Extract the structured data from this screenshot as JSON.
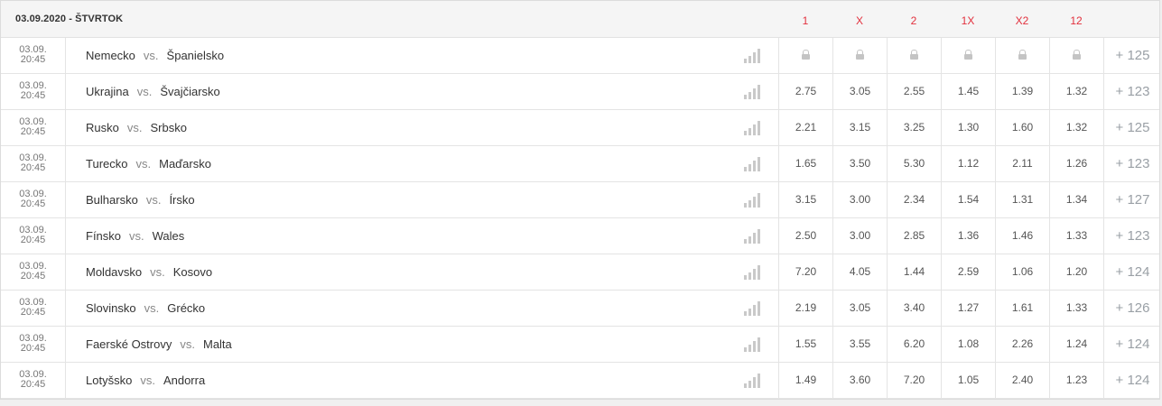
{
  "header": {
    "date_title": "03.09.2020 - ŠTVRTOK",
    "columns": [
      "1",
      "X",
      "2",
      "1X",
      "X2",
      "12"
    ]
  },
  "rows": [
    {
      "date": "03.09.",
      "time": "20:45",
      "home": "Nemecko",
      "vs": "vs.",
      "away": "Španielsko",
      "locked": true,
      "odds": [
        "",
        "",
        "",
        "",
        "",
        ""
      ],
      "more": "+ 125"
    },
    {
      "date": "03.09.",
      "time": "20:45",
      "home": "Ukrajina",
      "vs": "vs.",
      "away": "Švajčiarsko",
      "locked": false,
      "odds": [
        "2.75",
        "3.05",
        "2.55",
        "1.45",
        "1.39",
        "1.32"
      ],
      "more": "+ 123"
    },
    {
      "date": "03.09.",
      "time": "20:45",
      "home": "Rusko",
      "vs": "vs.",
      "away": "Srbsko",
      "locked": false,
      "odds": [
        "2.21",
        "3.15",
        "3.25",
        "1.30",
        "1.60",
        "1.32"
      ],
      "more": "+ 125"
    },
    {
      "date": "03.09.",
      "time": "20:45",
      "home": "Turecko",
      "vs": "vs.",
      "away": "Maďarsko",
      "locked": false,
      "odds": [
        "1.65",
        "3.50",
        "5.30",
        "1.12",
        "2.11",
        "1.26"
      ],
      "more": "+ 123"
    },
    {
      "date": "03.09.",
      "time": "20:45",
      "home": "Bulharsko",
      "vs": "vs.",
      "away": "Írsko",
      "locked": false,
      "odds": [
        "3.15",
        "3.00",
        "2.34",
        "1.54",
        "1.31",
        "1.34"
      ],
      "more": "+ 127"
    },
    {
      "date": "03.09.",
      "time": "20:45",
      "home": "Fínsko",
      "vs": "vs.",
      "away": "Wales",
      "locked": false,
      "odds": [
        "2.50",
        "3.00",
        "2.85",
        "1.36",
        "1.46",
        "1.33"
      ],
      "more": "+ 123"
    },
    {
      "date": "03.09.",
      "time": "20:45",
      "home": "Moldavsko",
      "vs": "vs.",
      "away": "Kosovo",
      "locked": false,
      "odds": [
        "7.20",
        "4.05",
        "1.44",
        "2.59",
        "1.06",
        "1.20"
      ],
      "more": "+ 124"
    },
    {
      "date": "03.09.",
      "time": "20:45",
      "home": "Slovinsko",
      "vs": "vs.",
      "away": "Grécko",
      "locked": false,
      "odds": [
        "2.19",
        "3.05",
        "3.40",
        "1.27",
        "1.61",
        "1.33"
      ],
      "more": "+ 126"
    },
    {
      "date": "03.09.",
      "time": "20:45",
      "home": "Faerské Ostrovy",
      "vs": "vs.",
      "away": "Malta",
      "locked": false,
      "odds": [
        "1.55",
        "3.55",
        "6.20",
        "1.08",
        "2.26",
        "1.24"
      ],
      "more": "+ 124"
    },
    {
      "date": "03.09.",
      "time": "20:45",
      "home": "Lotyšsko",
      "vs": "vs.",
      "away": "Andorra",
      "locked": false,
      "odds": [
        "1.49",
        "3.60",
        "7.20",
        "1.05",
        "2.40",
        "1.23"
      ],
      "more": "+ 124"
    }
  ],
  "icons": {
    "stats": "bar-chart-icon",
    "lock": "lock-icon"
  },
  "colors": {
    "column_header": "#e2303d",
    "more_link": "#9aa0a6"
  }
}
